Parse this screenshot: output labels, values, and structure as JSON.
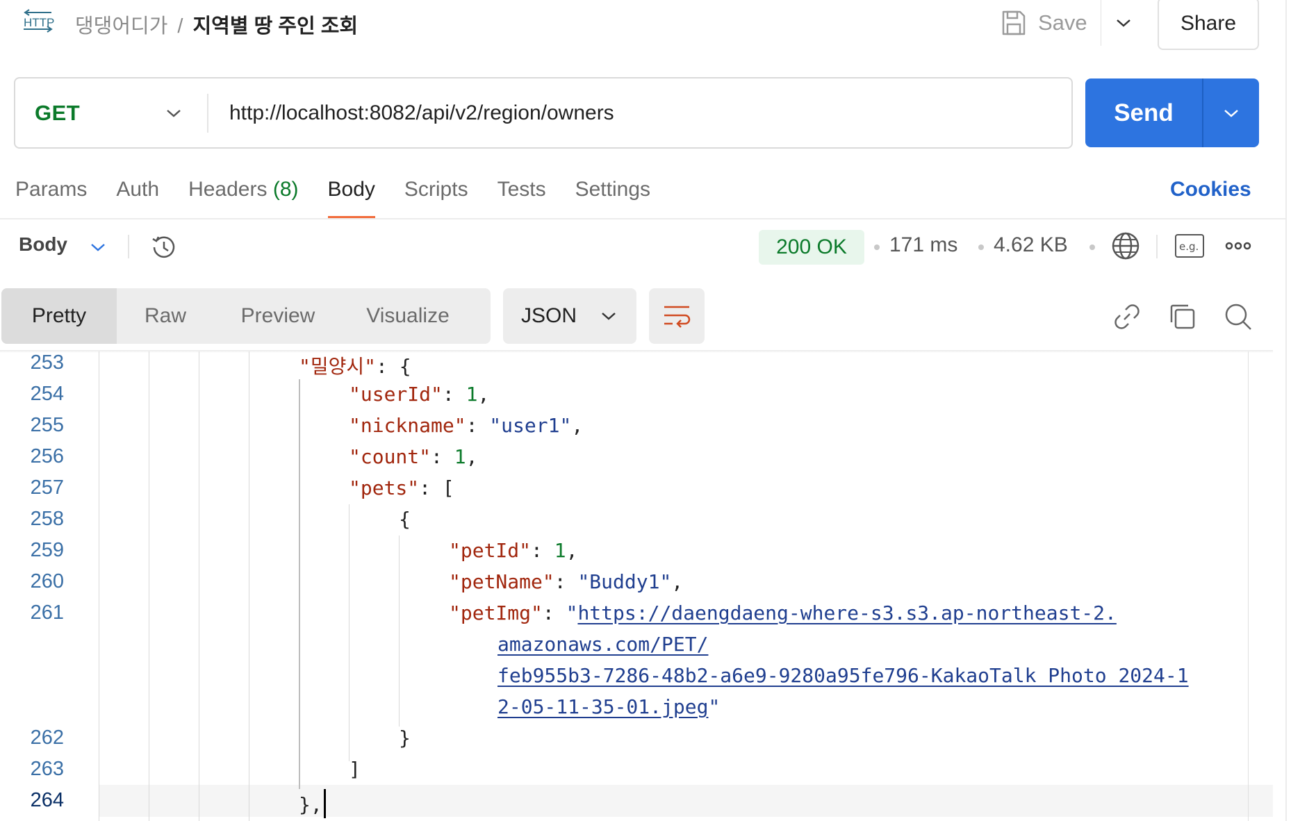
{
  "header": {
    "http_badge": "HTTP",
    "breadcrumb_parent": "댕댕어디가",
    "breadcrumb_sep": "/",
    "breadcrumb_current": "지역별 땅 주인 조회",
    "save_label": "Save",
    "share_label": "Share"
  },
  "request": {
    "method": "GET",
    "url": "http://localhost:8082/api/v2/region/owners",
    "send_label": "Send"
  },
  "request_tabs": {
    "params": "Params",
    "auth": "Auth",
    "headers": "Headers",
    "headers_count": "(8)",
    "body": "Body",
    "scripts": "Scripts",
    "tests": "Tests",
    "settings": "Settings",
    "cookies": "Cookies",
    "active": "Body"
  },
  "response": {
    "body_label": "Body",
    "status": "200 OK",
    "time": "171 ms",
    "size": "4.62 KB",
    "example_label": "e.g."
  },
  "format": {
    "tabs": [
      "Pretty",
      "Raw",
      "Preview",
      "Visualize"
    ],
    "active_tab": "Pretty",
    "language": "JSON"
  },
  "editor": {
    "lines": {
      "l253": "253",
      "l254": "254",
      "l255": "255",
      "l256": "256",
      "l257": "257",
      "l258": "258",
      "l259": "259",
      "l260": "260",
      "l261": "261",
      "l262": "262",
      "l263": "263",
      "l264": "264"
    },
    "region_key": "\"밀양시\"",
    "userId_key": "\"userId\"",
    "userId_val": "1",
    "nickname_key": "\"nickname\"",
    "nickname_val": "\"user1\"",
    "count_key": "\"count\"",
    "count_val": "1",
    "pets_key": "\"pets\"",
    "petId_key": "\"petId\"",
    "petId_val": "1",
    "petName_key": "\"petName\"",
    "petName_val": "\"Buddy1\"",
    "petImg_key": "\"petImg\"",
    "petImg_url_1": "https://daengdaeng-where-s3.s3.ap-northeast-2.",
    "petImg_url_2": "amazonaws.com/PET/",
    "petImg_url_3": "feb955b3-7286-48b2-a6e9-9280a95fe796-KakaoTalk_Photo_2024-1",
    "petImg_url_4": "2-05-11-35-01.jpeg"
  },
  "colors": {
    "accent_send": "#2d74e0",
    "method_get": "#0b7a2a",
    "status_ok": "#0b7a2a",
    "tab_underline": "#f26b3a",
    "json_key": "#a1260d",
    "json_string": "#1f3e8f",
    "json_number": "#0b7a2a"
  },
  "icons": [
    "http-icon",
    "save-icon",
    "chevron-down-icon",
    "history-icon",
    "globe-icon",
    "example-icon",
    "more-icon",
    "wrap-icon",
    "link-icon",
    "copy-icon",
    "search-icon"
  ]
}
